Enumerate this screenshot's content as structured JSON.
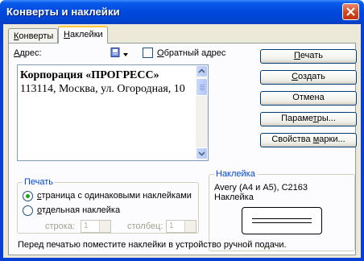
{
  "window": {
    "title": "Конверты и наклейки"
  },
  "tabs": [
    {
      "label": "Конверты",
      "accel": "К",
      "rest": "онверты",
      "active": false
    },
    {
      "label": "Наклейки",
      "accel": "Н",
      "rest": "аклейки",
      "active": true
    }
  ],
  "address": {
    "label_accel": "А",
    "label_rest": "дрес:",
    "lines": [
      "Корпорация «ПРОГРЕСС»",
      "113114, Москва, ул. Огородная, 10"
    ]
  },
  "return_address": {
    "label_accel": "О",
    "label_rest": "братный адрес",
    "checked": false
  },
  "buttons": {
    "print": {
      "accel": "П",
      "rest": "ечать"
    },
    "create": {
      "accel": "С",
      "rest": "оздать"
    },
    "cancel": "Отмена",
    "params_a": "Параме",
    "params_accel": "т",
    "params_b": "ры...",
    "props_a": "Свойства ",
    "props_accel": "м",
    "props_b": "арки..."
  },
  "print_group": {
    "legend": "Печать",
    "option_same": "страница с одинаковыми наклейками",
    "option_same_accel": "с",
    "option_same_rest": "траница с одинаковыми наклейками",
    "option_single": "отдельная наклейка",
    "option_single_accel": "о",
    "option_single_rest": "тдельная наклейка",
    "selected": "same",
    "row_label": "строка:",
    "row_value": "1",
    "col_label": "столбец:",
    "col_value": "1"
  },
  "label_group": {
    "legend": "Наклейка",
    "product": "Avery (A4 и A5), C2163",
    "type": "Наклейка"
  },
  "footer_note": "Перед печатью поместите наклейки в устройство ручной подачи.",
  "colors": {
    "titlebar": "#0048dc",
    "dialog_bg": "#ece9d8",
    "legend": "#0046d5",
    "radio_dot": "#21a121",
    "tab_highlight": "#ffc83c"
  }
}
